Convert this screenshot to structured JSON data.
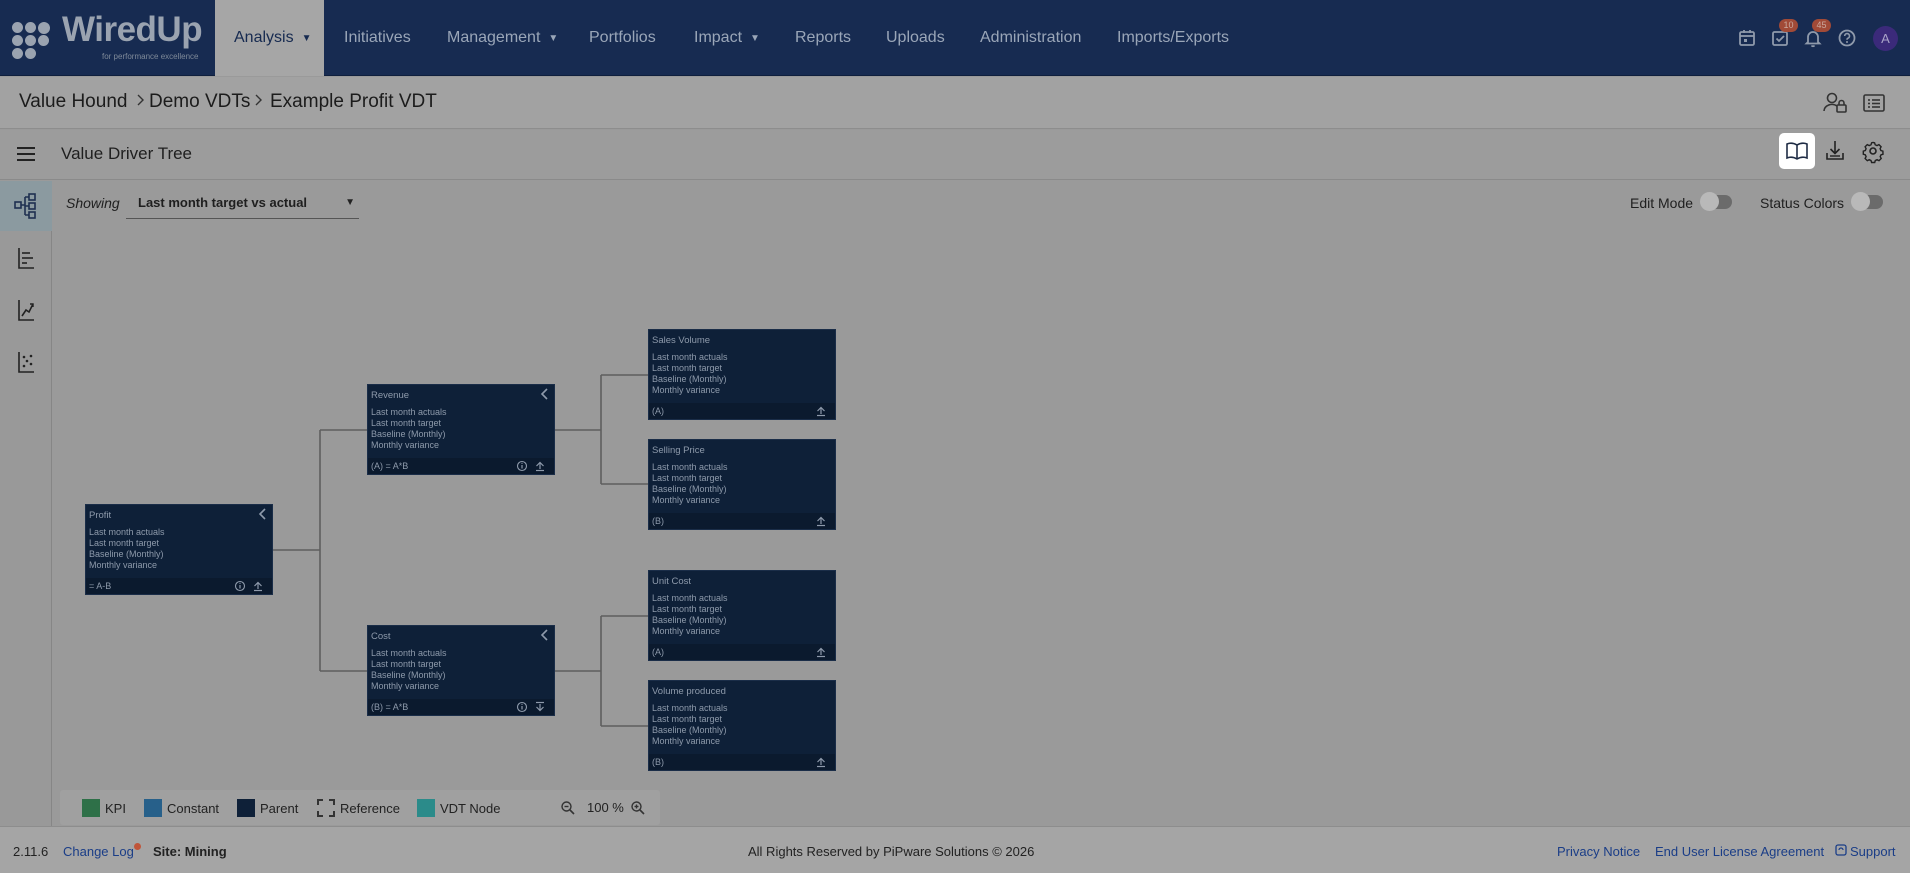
{
  "nav": {
    "logo": {
      "word": "WiredUp",
      "tagline": "for performance excellence"
    },
    "items": [
      {
        "label": "Analysis",
        "caret": true
      },
      {
        "label": "Initiatives",
        "caret": false
      },
      {
        "label": "Management",
        "caret": true
      },
      {
        "label": "Portfolios",
        "caret": false
      },
      {
        "label": "Impact",
        "caret": true
      },
      {
        "label": "Reports",
        "caret": false
      },
      {
        "label": "Uploads",
        "caret": false
      },
      {
        "label": "Administration",
        "caret": false
      },
      {
        "label": "Imports/Exports",
        "caret": false
      }
    ],
    "tasks_badge": "10",
    "notifications_badge": "45",
    "avatar": "A"
  },
  "breadcrumb": [
    "Value Hound",
    "Demo VDTs",
    "Example Profit VDT"
  ],
  "vdt": {
    "title": "Value Driver Tree",
    "showing_label": "Showing",
    "showing_value": "Last month target vs actual",
    "edit_mode_label": "Edit Mode",
    "status_colors_label": "Status Colors"
  },
  "nodes": {
    "profit": {
      "title": "Profit",
      "lines": [
        "Last month actuals",
        "Last month target",
        "Baseline (Monthly)",
        "Monthly variance"
      ],
      "formula": "= A-B"
    },
    "revenue": {
      "title": "Revenue",
      "lines": [
        "Last month actuals",
        "Last month target",
        "Baseline (Monthly)",
        "Monthly variance"
      ],
      "formula": "(A) = A*B"
    },
    "cost": {
      "title": "Cost",
      "lines": [
        "Last month actuals",
        "Last month target",
        "Baseline (Monthly)",
        "Monthly variance"
      ],
      "formula": "(B) = A*B"
    },
    "sales_volume": {
      "title": "Sales Volume",
      "lines": [
        "Last month actuals",
        "Last month target",
        "Baseline (Monthly)",
        "Monthly variance"
      ],
      "formula": "(A)"
    },
    "selling_price": {
      "title": "Selling Price",
      "lines": [
        "Last month actuals",
        "Last month target",
        "Baseline (Monthly)",
        "Monthly variance"
      ],
      "formula": "(B)"
    },
    "unit_cost": {
      "title": "Unit Cost",
      "lines": [
        "Last month actuals",
        "Last month target",
        "Baseline (Monthly)",
        "Monthly variance"
      ],
      "formula": "(A)"
    },
    "volume_produced": {
      "title": "Volume produced",
      "lines": [
        "Last month actuals",
        "Last month target",
        "Baseline (Monthly)",
        "Monthly variance"
      ],
      "formula": "(B)"
    }
  },
  "legend": {
    "items": [
      {
        "label": "KPI",
        "color": "#2e7048"
      },
      {
        "label": "Constant",
        "color": "#27608a"
      },
      {
        "label": "Parent",
        "color": "#0e2038"
      },
      {
        "label": "Reference",
        "color": "dashed"
      },
      {
        "label": "VDT Node",
        "color": "#2b8b8a"
      }
    ],
    "zoom": "100 %"
  },
  "footer": {
    "version": "2.11.6",
    "changelog": "Change Log",
    "site": "Site: Mining",
    "copyright": "All Rights Reserved by PiPware Solutions © 2026",
    "privacy": "Privacy Notice",
    "eula": "End User License Agreement",
    "support": "Support"
  }
}
